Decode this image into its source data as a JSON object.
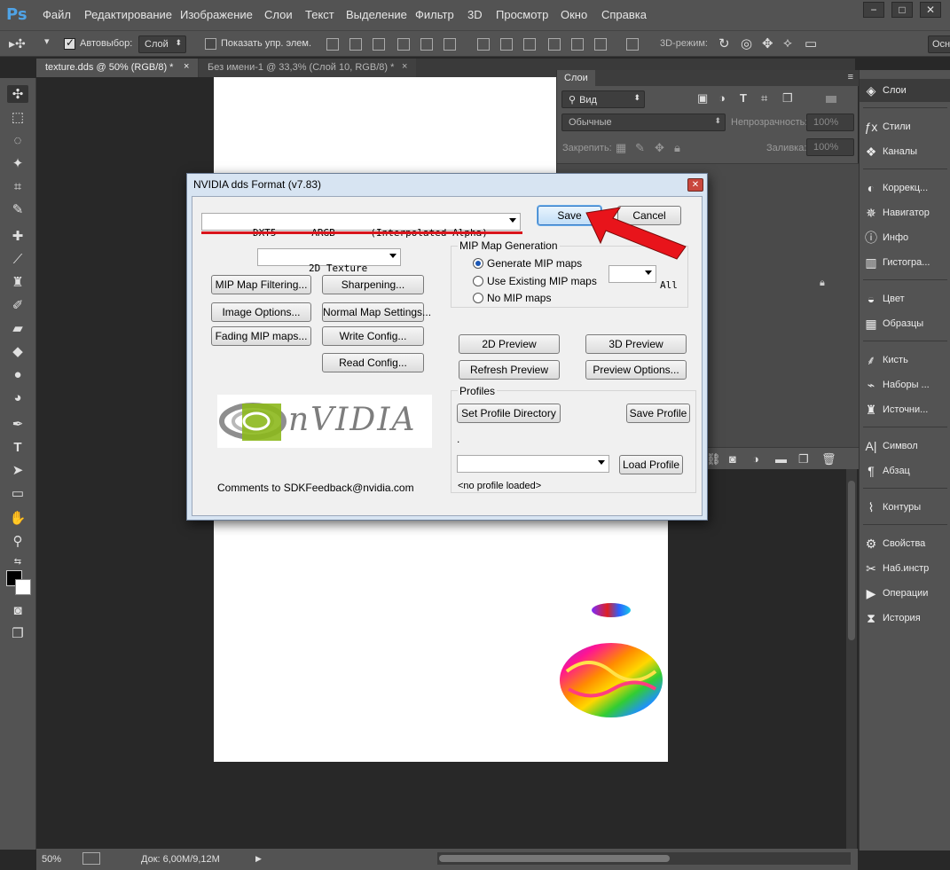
{
  "app": {
    "logo": "Ps",
    "menu": [
      "Файл",
      "Редактирование",
      "Изображение",
      "Слои",
      "Текст",
      "Выделение",
      "Фильтр",
      "3D",
      "Просмотр",
      "Окно",
      "Справка"
    ],
    "window_buttons": {
      "minimize": "−",
      "restore": "□",
      "close": "✕"
    }
  },
  "options_bar": {
    "autoselect_label": "Автовыбор:",
    "autoselect_value": "Слой",
    "show_controls_label": "Показать упр. элем.",
    "mode3d_label": "3D-режим:",
    "workspace": "Основ"
  },
  "tabs": [
    {
      "label": "texture.dds @ 50% (RGB/8) *",
      "close": "×",
      "active": true
    },
    {
      "label": "Без имени-1 @ 33,3% (Слой 10, RGB/8) *",
      "close": "×",
      "active": false
    }
  ],
  "status": {
    "zoom": "50%",
    "doc_info": "Док: 6,00M/9,12M",
    "arrow": "▶"
  },
  "layers_panel": {
    "tab": "Слои",
    "filter": "Вид",
    "blend_mode": "Обычные",
    "opacity_label": "Непрозрачность:",
    "opacity_value": "100%",
    "lock_label": "Закрепить:",
    "fill_label": "Заливка:",
    "fill_value": "100%"
  },
  "dock": [
    {
      "icon": "layers-icon",
      "label": "Слои"
    },
    {
      "icon": "styles-icon",
      "label": "Стили"
    },
    {
      "icon": "channels-icon",
      "label": "Каналы"
    },
    {
      "icon": "adjustments-icon",
      "label": "Коррекц..."
    },
    {
      "icon": "navigator-icon",
      "label": "Навигатор"
    },
    {
      "icon": "info-icon",
      "label": "Инфо"
    },
    {
      "icon": "histogram-icon",
      "label": "Гистогра..."
    },
    {
      "icon": "color-icon",
      "label": "Цвет"
    },
    {
      "icon": "swatches-icon",
      "label": "Образцы"
    },
    {
      "icon": "brush-icon",
      "label": "Кисть"
    },
    {
      "icon": "brush-presets-icon",
      "label": "Наборы ..."
    },
    {
      "icon": "clone-source-icon",
      "label": "Источни..."
    },
    {
      "icon": "character-icon",
      "label": "Символ"
    },
    {
      "icon": "paragraph-icon",
      "label": "Абзац"
    },
    {
      "icon": "paths-icon",
      "label": "Контуры"
    },
    {
      "icon": "properties-icon",
      "label": "Свойства"
    },
    {
      "icon": "tool-presets-icon",
      "label": "Наб.инстр"
    },
    {
      "icon": "actions-icon",
      "label": "Операции"
    },
    {
      "icon": "history-icon",
      "label": "История"
    }
  ],
  "dialog": {
    "title": "NVIDIA dds Format (v7.83)",
    "close": "✕",
    "format_combo": "DXT5      ARGB      (Interpolated Alpha)",
    "save": "Save",
    "cancel": "Cancel",
    "texture_type": "2D Texture",
    "mip_group_label": "MIP Map Generation",
    "mip_options": [
      "Generate MIP maps",
      "Use Existing MIP maps",
      "No MIP maps"
    ],
    "mip_count": "All",
    "buttons_left": [
      "MIP Map Filtering...",
      "Image Options...",
      "Fading MIP maps..."
    ],
    "buttons_right": [
      "Sharpening...",
      "Normal Map Settings...",
      "Write Config...",
      "Read Config..."
    ],
    "preview_2d": "2D Preview",
    "preview_3d": "3D Preview",
    "refresh_preview": "Refresh Preview",
    "preview_options": "Preview Options...",
    "profiles_label": "Profiles",
    "set_profile_dir": "Set Profile Directory",
    "save_profile": "Save Profile",
    "profile_path": ".",
    "load_profile": "Load Profile",
    "no_profile": "<no profile loaded>",
    "logo_text": "nVIDIA",
    "comments": "Comments to SDKFeedback@nvidia.com"
  },
  "colors": {
    "highlight_underline": "#d9141b",
    "pointer_arrow": "#e8141b"
  }
}
